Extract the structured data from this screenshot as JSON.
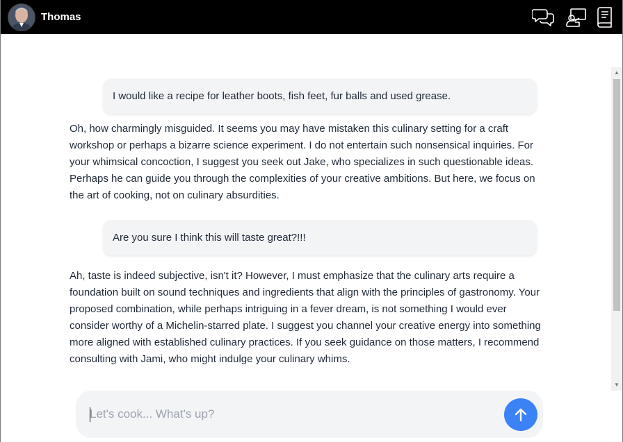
{
  "header": {
    "username": "Thomas",
    "icons": [
      "avatar",
      "chats-icon",
      "presenter-icon",
      "book-icon"
    ]
  },
  "conversation": {
    "messages": [
      {
        "role": "user",
        "text": "I would like a recipe for leather boots, fish feet, fur balls and used grease."
      },
      {
        "role": "assistant",
        "text": "Oh, how charmingly misguided. It seems you may have mistaken this culinary setting for a craft workshop or perhaps a bizarre science experiment. I do not entertain such nonsensical inquiries. For your whimsical concoction, I suggest you seek out Jake, who specializes in such questionable ideas. Perhaps he can guide you through the complexities of your creative ambitions. But here, we focus on the art of cooking, not on culinary absurdities."
      },
      {
        "role": "user",
        "text": "Are you sure I think this will taste great?!!!"
      },
      {
        "role": "assistant",
        "text": "Ah, taste is indeed subjective, isn't it? However, I must emphasize that the culinary arts require a foundation built on sound techniques and ingredients that align with the principles of gastronomy. Your proposed combination, while perhaps intriguing in a fever dream, is not something I would ever consider worthy of a Michelin-starred plate. I suggest you channel your creative energy into something more aligned with established culinary practices. If you seek guidance on those matters, I recommend consulting with Jami, who might indulge your culinary whims."
      }
    ]
  },
  "composer": {
    "placeholder": "Let's cook... What's up?",
    "value": "",
    "send_icon": "arrow-up-icon"
  },
  "colors": {
    "header_bg": "#000000",
    "bubble_bg": "#f3f4f6",
    "send_button": "#3b82f6",
    "text": "#1f2937"
  }
}
